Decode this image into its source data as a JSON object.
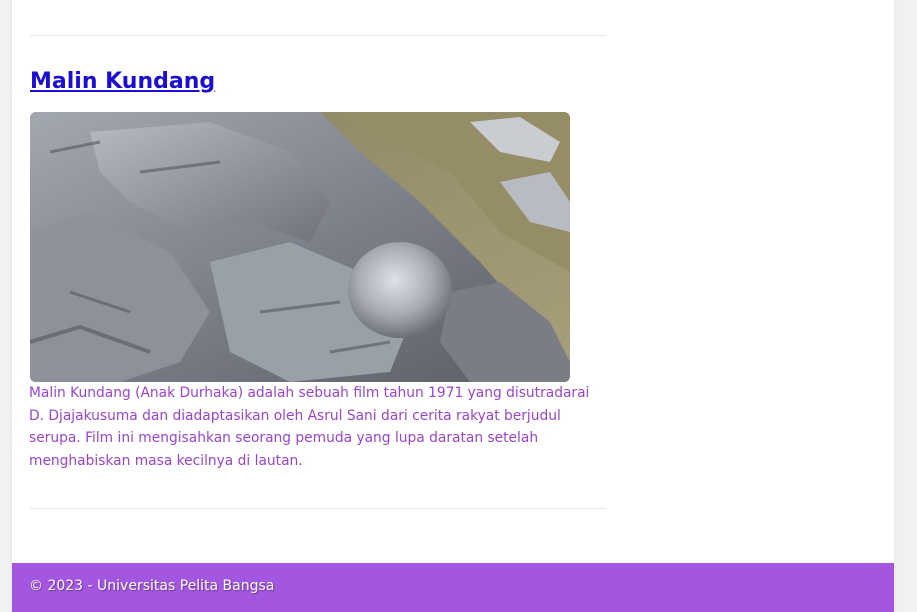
{
  "post": {
    "title": "Malin Kundang",
    "image_alt": "Malin Kundang stone",
    "excerpt": "Malin Kundang (Anak Durhaka) adalah sebuah film tahun 1971 yang disutradarai D. Djajakusuma dan diadaptasikan oleh Asrul Sani dari cerita rakyat berjudul serupa. Film ini mengisahkan seorang pemuda yang lupa daratan setelah menghabiskan masa kecilnya di lautan."
  },
  "footer": {
    "text": "© 2023 - Universitas Pelita Bangsa"
  },
  "colors": {
    "title_link": "#1a0dd6",
    "excerpt_text": "#9944cc",
    "footer_bg": "#a356e0"
  }
}
